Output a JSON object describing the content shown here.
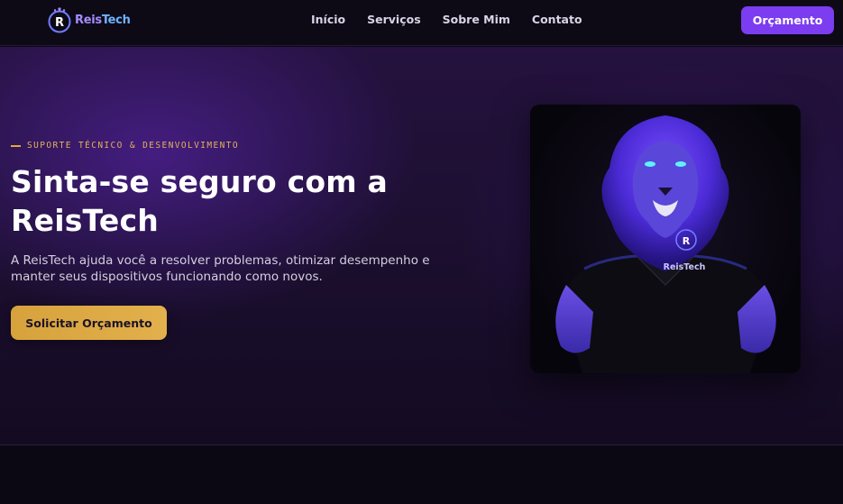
{
  "brand": {
    "name_part1": "Reis",
    "name_part2": "Tech",
    "logo_letter": "R",
    "colors": {
      "primary": "#7c3cf0",
      "accent_gold": "#e3a83c",
      "logo_blue": "#6fb2ff",
      "logo_purple": "#a58bff"
    }
  },
  "nav": {
    "links": [
      "Início",
      "Serviços",
      "Sobre Mim",
      "Contato"
    ],
    "cta_label": "Orçamento"
  },
  "hero": {
    "eyebrow": "SUPORTE TÉCNICO & DESENVOLVIMENTO",
    "title_line1": "Sinta-se seguro com a",
    "title_line2": "ReisTech",
    "description": "A ReisTech ajuda você a resolver problemas, otimizar desempenho e manter seus dispositivos funcionando como novos.",
    "cta_label": "Solicitar Orçamento",
    "image": {
      "subject": "lion-mascot-in-black-polo",
      "shirt_text": "ReisTech",
      "shirt_logo_letter": "R"
    }
  }
}
